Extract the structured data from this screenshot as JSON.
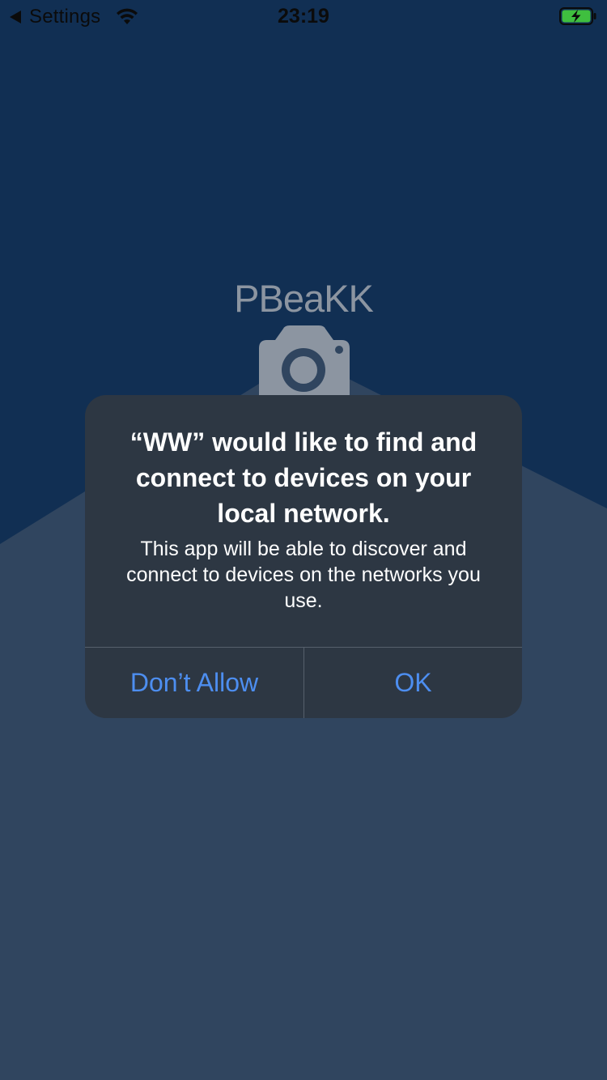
{
  "status_bar": {
    "back_label": "Settings",
    "time": "23:19",
    "wifi_icon": "wifi-icon",
    "battery_icon": "battery-charging-icon",
    "battery_color": "#3fbf3f"
  },
  "background": {
    "logo_text": "PBeaKK",
    "logo_icon": "camera-icon",
    "top_color": "#112f53",
    "bottom_color": "#30455f"
  },
  "alert": {
    "title": "“WW” would like to find and connect to devices on your local network.",
    "message": "This app will be able to discover and connect to devices on the networks you use.",
    "buttons": {
      "dont_allow": "Don’t Allow",
      "ok": "OK"
    },
    "button_color": "#4d8ef0"
  }
}
